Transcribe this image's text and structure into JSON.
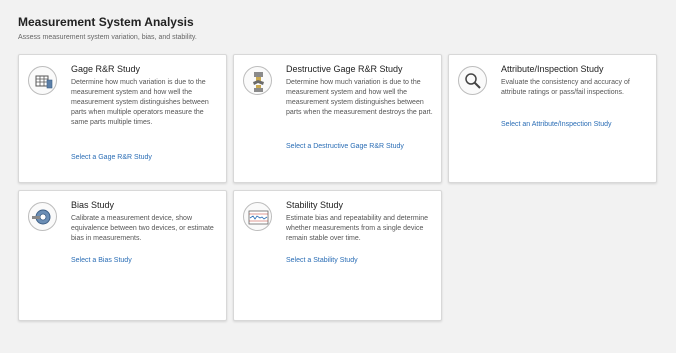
{
  "header": {
    "title": "Measurement System Analysis",
    "subtitle": "Assess measurement system variation, bias, and stability."
  },
  "cards": [
    {
      "title": "Gage R&R Study",
      "description": "Determine how much variation is due to the measurement system and how well the measurement system distinguishes between parts when multiple operators measure the same parts multiple times.",
      "link": "Select a Gage R&R Study",
      "icon": "gage-rr-icon"
    },
    {
      "title": "Destructive Gage R&R Study",
      "description": "Determine how much variation is due to the measurement system and how well the measurement system distinguishes between parts when the measurement destroys the part.",
      "link": "Select a Destructive Gage R&R Study",
      "icon": "destructive-gage-icon"
    },
    {
      "title": "Attribute/Inspection Study",
      "description": "Evaluate the consistency and accuracy of attribute ratings or pass/fail inspections.",
      "link": "Select an Attribute/Inspection Study",
      "icon": "magnifier-icon"
    },
    {
      "title": "Bias Study",
      "description": "Calibrate a measurement device, show equivalence between two devices, or estimate bias in measurements.",
      "link": "Select a Bias Study",
      "icon": "caliper-icon"
    },
    {
      "title": "Stability Study",
      "description": "Estimate bias and repeatability and determine whether measurements from a single device remain stable over time.",
      "link": "Select a Stability Study",
      "icon": "control-chart-icon"
    }
  ],
  "colors": {
    "link": "#2a6db5",
    "background": "#f2f2f2",
    "card": "#ffffff"
  }
}
